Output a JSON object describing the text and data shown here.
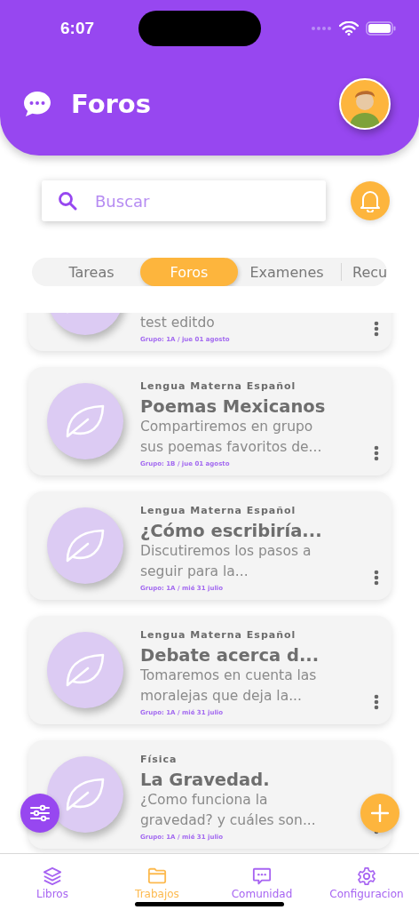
{
  "status_bar": {
    "time": "6:07"
  },
  "header": {
    "title": "Foros"
  },
  "search": {
    "placeholder": "Buscar"
  },
  "tabs": [
    {
      "label": "Tareas",
      "selected": false
    },
    {
      "label": "Foros",
      "selected": true
    },
    {
      "label": "Examenes",
      "selected": false
    },
    {
      "label": "Recu",
      "selected": false
    }
  ],
  "forums": [
    {
      "description": "test editdo",
      "meta": "Grupo: 1A / jue 01 agosto"
    },
    {
      "subject": "Lengua Materna Español",
      "title": "Poemas Mexicanos",
      "description": "Compartiremos en grupo sus poemas favoritos de...",
      "meta": "Grupo: 1B / jue 01 agosto"
    },
    {
      "subject": "Lengua Materna Español",
      "title": "¿Cómo escribiría...",
      "description": "Discutiremos los pasos a seguir para la...",
      "meta": "Grupo: 1A / mié 31 julio"
    },
    {
      "subject": "Lengua Materna Español",
      "title": "Debate acerca d...",
      "description": "Tomaremos en cuenta las moralejas que deja la...",
      "meta": "Grupo: 1A / mié 31 julio"
    },
    {
      "subject": "Física",
      "title": "La Gravedad.",
      "description": "¿Como funciona la gravedad? y cuáles son...",
      "meta": "Grupo: 1A / mié 31 julio"
    }
  ],
  "bottom_nav": [
    {
      "label": "Libros",
      "kind": "layers",
      "selected": false
    },
    {
      "label": "Trabajos",
      "kind": "folder",
      "selected": true
    },
    {
      "label": "Comunidad",
      "kind": "chat",
      "selected": false
    },
    {
      "label": "Configuracion",
      "kind": "gear",
      "selected": false
    }
  ]
}
